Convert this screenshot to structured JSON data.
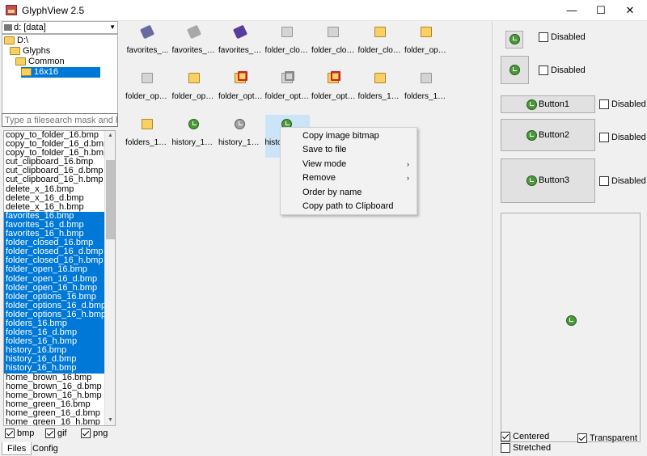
{
  "window": {
    "title": "GlyphView 2.5",
    "minimize": "—",
    "maximize": "☐",
    "close": "✕"
  },
  "drive": {
    "label": "d: [data]"
  },
  "tree": [
    {
      "label": "D:\\",
      "indent": 0
    },
    {
      "label": "Glyphs",
      "indent": 1
    },
    {
      "label": "Common",
      "indent": 2
    },
    {
      "label": "16x16",
      "indent": 3,
      "selected": true
    }
  ],
  "search": {
    "placeholder": "Type a filesearch mask and hit Enter"
  },
  "files": [
    {
      "name": "copy_to_folder_16.bmp",
      "sel": false
    },
    {
      "name": "copy_to_folder_16_d.bmp",
      "sel": false
    },
    {
      "name": "copy_to_folder_16_h.bmp",
      "sel": false
    },
    {
      "name": "cut_clipboard_16.bmp",
      "sel": false
    },
    {
      "name": "cut_clipboard_16_d.bmp",
      "sel": false
    },
    {
      "name": "cut_clipboard_16_h.bmp",
      "sel": false
    },
    {
      "name": "delete_x_16.bmp",
      "sel": false
    },
    {
      "name": "delete_x_16_d.bmp",
      "sel": false
    },
    {
      "name": "delete_x_16_h.bmp",
      "sel": false
    },
    {
      "name": "favorites_16.bmp",
      "sel": true
    },
    {
      "name": "favorites_16_d.bmp",
      "sel": true
    },
    {
      "name": "favorites_16_h.bmp",
      "sel": true
    },
    {
      "name": "folder_closed_16.bmp",
      "sel": true
    },
    {
      "name": "folder_closed_16_d.bmp",
      "sel": true
    },
    {
      "name": "folder_closed_16_h.bmp",
      "sel": true
    },
    {
      "name": "folder_open_16.bmp",
      "sel": true
    },
    {
      "name": "folder_open_16_d.bmp",
      "sel": true
    },
    {
      "name": "folder_open_16_h.bmp",
      "sel": true
    },
    {
      "name": "folder_options_16.bmp",
      "sel": true
    },
    {
      "name": "folder_options_16_d.bmp",
      "sel": true
    },
    {
      "name": "folder_options_16_h.bmp",
      "sel": true
    },
    {
      "name": "folders_16.bmp",
      "sel": true
    },
    {
      "name": "folders_16_d.bmp",
      "sel": true
    },
    {
      "name": "folders_16_h.bmp",
      "sel": true
    },
    {
      "name": "history_16.bmp",
      "sel": true
    },
    {
      "name": "history_16_d.bmp",
      "sel": true
    },
    {
      "name": "history_16_h.bmp",
      "sel": true
    },
    {
      "name": "home_brown_16.bmp",
      "sel": false
    },
    {
      "name": "home_brown_16_d.bmp",
      "sel": false
    },
    {
      "name": "home_brown_16_h.bmp",
      "sel": false
    },
    {
      "name": "home_green_16.bmp",
      "sel": false
    },
    {
      "name": "home_green_16_d.bmp",
      "sel": false
    },
    {
      "name": "home_green_16_h.bmp",
      "sel": false
    }
  ],
  "filters": [
    {
      "label": "bmp",
      "checked": true
    },
    {
      "label": "gif",
      "checked": true
    },
    {
      "label": "png",
      "checked": true
    }
  ],
  "tabs": [
    {
      "label": "Files",
      "active": true
    },
    {
      "label": "Config",
      "active": false
    }
  ],
  "thumbnails": [
    {
      "label": "favorites_...",
      "icon": "favorites-icon",
      "variant": ""
    },
    {
      "label": "favorites_1...",
      "icon": "favorites-icon",
      "variant": "d"
    },
    {
      "label": "favorites_1...",
      "icon": "favorites-icon",
      "variant": "h"
    },
    {
      "label": "folder_clos...",
      "icon": "folder-icon",
      "variant": "d"
    },
    {
      "label": "folder_clos...",
      "icon": "folder-icon",
      "variant": "d"
    },
    {
      "label": "folder_clos...",
      "icon": "folder-icon",
      "variant": ""
    },
    {
      "label": "folder_ope...",
      "icon": "folder-icon",
      "variant": ""
    },
    {
      "label": "folder_ope...",
      "icon": "folder-icon",
      "variant": "d"
    },
    {
      "label": "folder_ope...",
      "icon": "folder-icon",
      "variant": ""
    },
    {
      "label": "folder_opti...",
      "icon": "folder-options-icon",
      "variant": ""
    },
    {
      "label": "folder_opti...",
      "icon": "folder-options-icon",
      "variant": "d"
    },
    {
      "label": "folder_opti...",
      "icon": "folder-options-icon",
      "variant": ""
    },
    {
      "label": "folders_16....",
      "icon": "folder-icon",
      "variant": ""
    },
    {
      "label": "folders_16...",
      "icon": "folder-icon",
      "variant": "d"
    },
    {
      "label": "folders_16...",
      "icon": "folder-icon",
      "variant": ""
    },
    {
      "label": "history_16....",
      "icon": "history-icon",
      "variant": ""
    },
    {
      "label": "history_16....",
      "icon": "history-icon",
      "variant": "d"
    },
    {
      "label": "history_16....",
      "icon": "history-icon",
      "variant": "",
      "selected": true
    }
  ],
  "context_menu": [
    {
      "label": "Copy image bitmap",
      "submenu": false
    },
    {
      "label": "Save to file",
      "submenu": false
    },
    {
      "label": "View mode",
      "submenu": true
    },
    {
      "label": "Remove",
      "submenu": true
    },
    {
      "label": "Order by name",
      "submenu": false
    },
    {
      "label": "Copy path to Clipboard",
      "submenu": false
    }
  ],
  "preview_panel": {
    "disabled_label": "Disabled",
    "button1": "Button1",
    "button2": "Button2",
    "button3": "Button3",
    "centered": "Centered",
    "stretched": "Stretched",
    "transparent": "Transparent",
    "centered_checked": true,
    "stretched_checked": false,
    "transparent_checked": true
  }
}
